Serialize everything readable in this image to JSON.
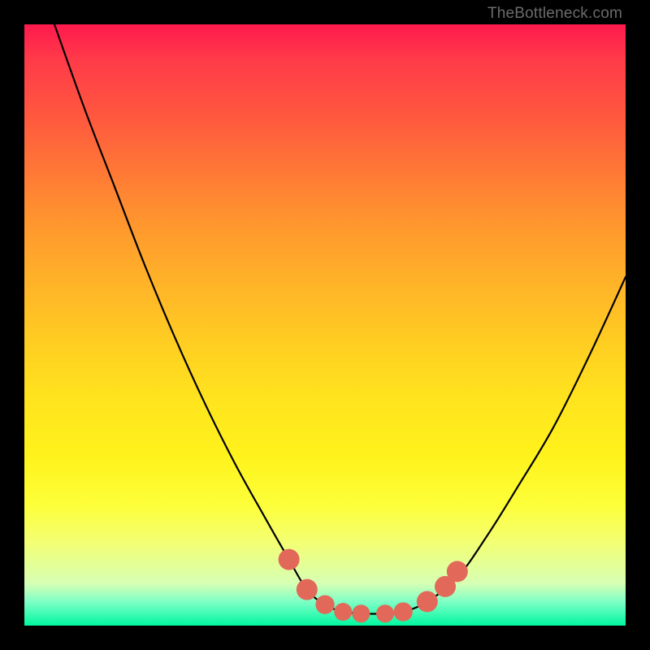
{
  "watermark": "TheBottleneck.com",
  "chart_data": {
    "type": "line",
    "title": "",
    "xlabel": "",
    "ylabel": "",
    "xlim": [
      0,
      100
    ],
    "ylim": [
      0,
      100
    ],
    "series": [
      {
        "name": "curve",
        "x": [
          5,
          10,
          15,
          20,
          25,
          30,
          35,
          40,
          44,
          47,
          50,
          53,
          56,
          60,
          63,
          67,
          72,
          77,
          82,
          88,
          94,
          100
        ],
        "values": [
          100,
          86,
          73,
          60,
          48,
          37,
          27,
          18,
          11,
          6,
          3.5,
          2.3,
          2,
          2,
          2.3,
          4,
          8,
          15,
          23,
          33,
          45,
          58
        ]
      }
    ],
    "dots": [
      {
        "x": 44,
        "y": 11,
        "r": 1.5
      },
      {
        "x": 47,
        "y": 6,
        "r": 1.5
      },
      {
        "x": 50,
        "y": 3.5,
        "r": 1.3
      },
      {
        "x": 53,
        "y": 2.3,
        "r": 1.2
      },
      {
        "x": 56,
        "y": 2,
        "r": 1.2
      },
      {
        "x": 60,
        "y": 2,
        "r": 1.2
      },
      {
        "x": 63,
        "y": 2.3,
        "r": 1.3
      },
      {
        "x": 67,
        "y": 4,
        "r": 1.5
      },
      {
        "x": 70,
        "y": 6.5,
        "r": 1.5
      },
      {
        "x": 72,
        "y": 9,
        "r": 1.5
      }
    ],
    "colors": {
      "curve": "#000000",
      "dots": "#e2695a"
    }
  }
}
